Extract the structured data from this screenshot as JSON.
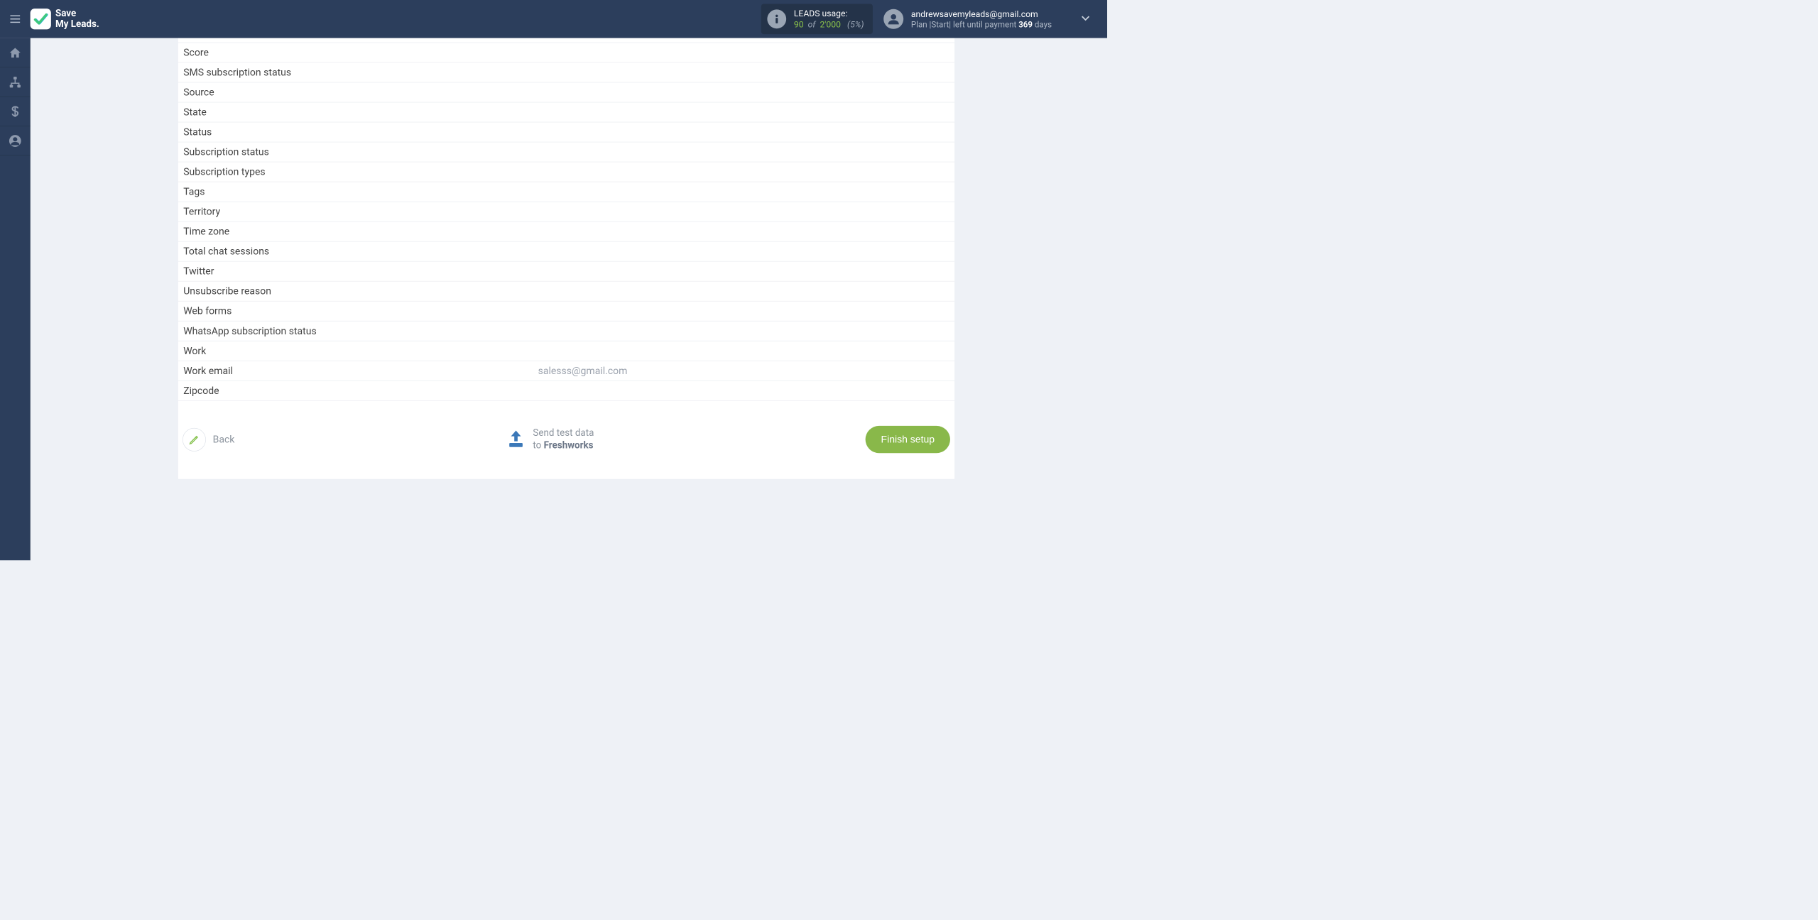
{
  "header": {
    "logo_text_line1": "Save",
    "logo_text_line2": "My Leads.",
    "usage": {
      "label": "LEADS usage:",
      "used": "90",
      "of": "of",
      "total": "2'000",
      "percent": "(5%)"
    },
    "account": {
      "email": "andrewsavemyleads@gmail.com",
      "plan_prefix": "Plan |Start| left until payment ",
      "days": "369",
      "plan_suffix": " days"
    }
  },
  "fields": [
    {
      "label": "Score",
      "value": ""
    },
    {
      "label": "SMS subscription status",
      "value": ""
    },
    {
      "label": "Source",
      "value": ""
    },
    {
      "label": "State",
      "value": ""
    },
    {
      "label": "Status",
      "value": ""
    },
    {
      "label": "Subscription status",
      "value": ""
    },
    {
      "label": "Subscription types",
      "value": ""
    },
    {
      "label": "Tags",
      "value": ""
    },
    {
      "label": "Territory",
      "value": ""
    },
    {
      "label": "Time zone",
      "value": ""
    },
    {
      "label": "Total chat sessions",
      "value": ""
    },
    {
      "label": "Twitter",
      "value": ""
    },
    {
      "label": "Unsubscribe reason",
      "value": ""
    },
    {
      "label": "Web forms",
      "value": ""
    },
    {
      "label": "WhatsApp subscription status",
      "value": ""
    },
    {
      "label": "Work",
      "value": ""
    },
    {
      "label": "Work email",
      "value": "salesss@gmail.com"
    },
    {
      "label": "Zipcode",
      "value": ""
    }
  ],
  "actions": {
    "back_label": "Back",
    "send_line1": "Send test data",
    "send_to": "to ",
    "send_dest": "Freshworks",
    "finish_label": "Finish setup"
  }
}
